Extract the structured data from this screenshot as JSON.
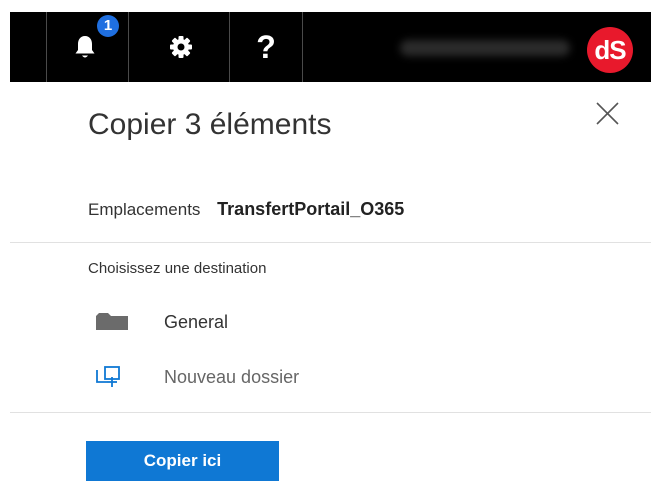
{
  "header": {
    "notifications_count": "1",
    "notifications_icon": "bell-icon",
    "settings_icon": "gear-icon",
    "help_label": "?",
    "avatar_initials": "dS",
    "avatar_color": "#e8192c"
  },
  "panel": {
    "title": "Copier 3 éléments",
    "close_icon": "close-icon",
    "location_label": "Emplacements",
    "location_value": "TransfertPortail_O365",
    "destination_label": "Choisissez une destination",
    "destinations": [
      {
        "label": "General",
        "icon": "folder-icon"
      },
      {
        "label": "Nouveau dossier",
        "icon": "new-folder-icon"
      }
    ],
    "copy_button_label": "Copier ici"
  },
  "colors": {
    "topbar_background": "#000000",
    "accent": "#0f78d4",
    "badge": "#1f6fe0"
  }
}
